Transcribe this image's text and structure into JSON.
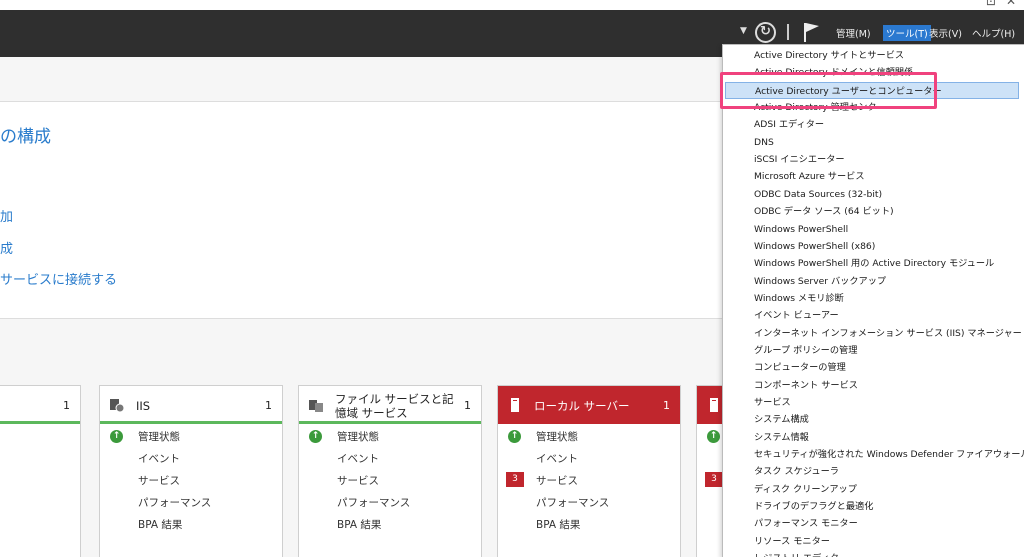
{
  "window": {
    "controls": [
      "⊡",
      "✕"
    ]
  },
  "toolbar": {
    "dropdown_icon": "dropdown-arrow",
    "refresh_icon": "refresh-icon",
    "flag_icon": "flag-icon",
    "menus": [
      {
        "label": "管理(M)"
      },
      {
        "label": "ツール(T)",
        "active": true
      },
      {
        "label": "表示(V)"
      },
      {
        "label": "ヘルプ(H)"
      }
    ],
    "accent_color": "#2b79d0"
  },
  "welcome": {
    "title": "の構成",
    "links": [
      "加",
      "成",
      "サービスに接続する"
    ]
  },
  "tiles": [
    {
      "title": "",
      "count": "1",
      "style": "green",
      "rows": []
    },
    {
      "title": "IIS",
      "count": "1",
      "style": "green",
      "icon": "iis-icon",
      "rows": [
        {
          "label": "管理状態",
          "status": "ok"
        },
        {
          "label": "イベント"
        },
        {
          "label": "サービス"
        },
        {
          "label": "パフォーマンス"
        },
        {
          "label": "BPA 結果"
        }
      ]
    },
    {
      "title": "ファイル サービスと記憶域 サービス",
      "count": "1",
      "style": "green",
      "icon": "file-services-icon",
      "rows": [
        {
          "label": "管理状態",
          "status": "ok"
        },
        {
          "label": "イベント"
        },
        {
          "label": "サービス"
        },
        {
          "label": "パフォーマンス"
        },
        {
          "label": "BPA 結果"
        }
      ]
    },
    {
      "title": "ローカル サーバー",
      "count": "1",
      "style": "red",
      "icon": "server-icon",
      "rows": [
        {
          "label": "管理状態",
          "status": "ok"
        },
        {
          "label": "イベント"
        },
        {
          "label": "サービス",
          "badge": "3"
        },
        {
          "label": "パフォーマンス"
        },
        {
          "label": "BPA 結果"
        }
      ]
    },
    {
      "title": "",
      "count": "",
      "style": "red",
      "icon": "server-icon",
      "rows": [
        {
          "label": "",
          "status": "ok"
        },
        {
          "label": ""
        },
        {
          "label": "",
          "badge": "3"
        }
      ]
    }
  ],
  "tools_menu": {
    "items": [
      "Active Directory サイトとサービス",
      "Active Directory ドメインと信頼関係",
      "Active Directory ユーザーとコンピューター",
      "Active Directory 管理センター",
      "ADSI エディター",
      "DNS",
      "iSCSI イニシエーター",
      "Microsoft Azure サービス",
      "ODBC Data Sources (32-bit)",
      "ODBC データ ソース (64 ビット)",
      "Windows PowerShell",
      "Windows PowerShell (x86)",
      "Windows PowerShell 用の Active Directory モジュール",
      "Windows Server バックアップ",
      "Windows メモリ診断",
      "イベント ビューアー",
      "インターネット インフォメーション サービス (IIS) マネージャー",
      "グループ ポリシーの管理",
      "コンピューターの管理",
      "コンポーネント サービス",
      "サービス",
      "システム構成",
      "システム情報",
      "セキュリティが強化された Windows Defender ファイアウォール",
      "タスク スケジューラ",
      "ディスク クリーンアップ",
      "ドライブのデフラグと最適化",
      "パフォーマンス モニター",
      "リソース モニター",
      "レジストリ エディター"
    ],
    "highlighted_index": 2,
    "annotation_color": "#f0427e"
  }
}
